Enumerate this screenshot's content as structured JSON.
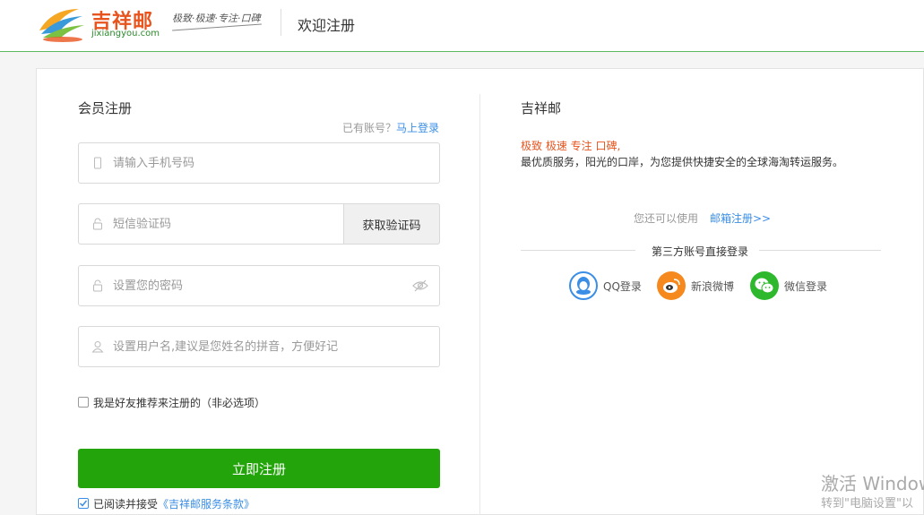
{
  "header": {
    "logo_cn": "吉祥邮",
    "logo_en": "jixiangyou.com",
    "slogan": "极致·极速·专注·口碑",
    "title": "欢迎注册"
  },
  "left": {
    "title": "会员注册",
    "has_account": "已有账号？",
    "login_link": "马上登录",
    "phone_placeholder": "请输入手机号码",
    "code_placeholder": "短信验证码",
    "get_code_button": "获取验证码",
    "password_placeholder": "设置您的密码",
    "username_placeholder": "设置用户名,建议是您姓名的拼音，方便好记",
    "referral_label": "我是好友推荐来注册的（非必选项）",
    "referral_checked": false,
    "submit_button": "立即注册",
    "agree_checked": true,
    "agree_text": "已阅读并接受",
    "agree_link": "《吉祥邮服务条款》"
  },
  "right": {
    "title": "吉祥邮",
    "tagline": "极致 极速 专注 口碑,",
    "description": "最优质服务，阳光的口岸，为您提供快捷安全的全球海淘转运服务。",
    "email_hint": "您还可以使用",
    "email_register_link": "邮箱注册>>",
    "third_party_title": "第三方账号直接登录",
    "social": [
      {
        "label": "QQ登录",
        "icon": "qq-icon",
        "color": "#3a8ee6"
      },
      {
        "label": "新浪微博",
        "icon": "weibo-icon",
        "color": "#f5891e"
      },
      {
        "label": "微信登录",
        "icon": "wechat-icon",
        "color": "#2db82d"
      }
    ]
  },
  "watermark": {
    "line1": "激活 Window",
    "line2": "转到\"电脑设置\"以"
  },
  "colors": {
    "brand_green": "#23a40b",
    "brand_orange": "#e8541e",
    "link_blue": "#3a8ee6"
  }
}
